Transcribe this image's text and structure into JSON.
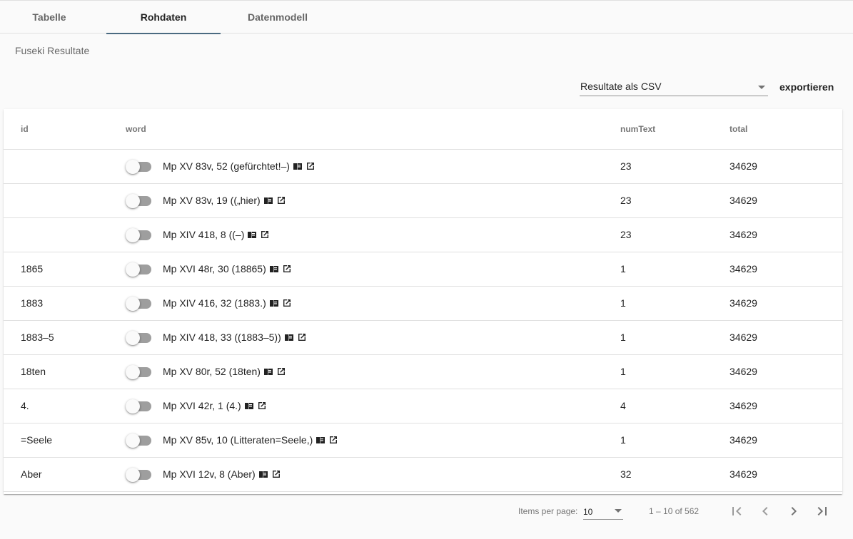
{
  "tabs": [
    {
      "label": "Tabelle",
      "active": false
    },
    {
      "label": "Rohdaten",
      "active": true
    },
    {
      "label": "Datenmodell",
      "active": false
    }
  ],
  "section_title": "Fuseki Resultate",
  "export": {
    "selected": "Resultate als CSV",
    "button_label": "exportieren"
  },
  "table": {
    "columns": [
      "id",
      "word",
      "numText",
      "total"
    ],
    "rows": [
      {
        "id": "",
        "word": "Mp XV 83v, 52 (gefürchtet!–)",
        "numText": "23",
        "total": "34629"
      },
      {
        "id": "",
        "word": "Mp XV 83v, 19 ((„hier)",
        "numText": "23",
        "total": "34629"
      },
      {
        "id": "",
        "word": "Mp XIV 418, 8 ((–)",
        "numText": "23",
        "total": "34629"
      },
      {
        "id": "1865",
        "word": "Mp XVI 48r, 30 (18865)",
        "numText": "1",
        "total": "34629"
      },
      {
        "id": "1883",
        "word": "Mp XIV 416, 32 (1883.)",
        "numText": "1",
        "total": "34629"
      },
      {
        "id": "1883–5",
        "word": "Mp XIV 418, 33 ((1883–5))",
        "numText": "1",
        "total": "34629"
      },
      {
        "id": "18ten",
        "word": "Mp XV 80r, 52 (18ten)",
        "numText": "1",
        "total": "34629"
      },
      {
        "id": "4.",
        "word": "Mp XVI 42r, 1 (4.)",
        "numText": "4",
        "total": "34629"
      },
      {
        "id": "=Seele",
        "word": "Mp XV 85v, 10 (Litteraten=Seele,)",
        "numText": "1",
        "total": "34629"
      },
      {
        "id": "Aber",
        "word": "Mp XVI 12v, 8 (Aber)",
        "numText": "32",
        "total": "34629"
      }
    ]
  },
  "paginator": {
    "items_per_page_label": "Items per page:",
    "items_per_page": "10",
    "range_label": "1 – 10 of 562"
  },
  "icons": {
    "row_icons": [
      "book-icon",
      "open-in-new-icon"
    ],
    "pager": [
      "first-page-icon",
      "chevron-left-icon",
      "chevron-right-icon",
      "last-page-icon"
    ]
  },
  "colors": {
    "tab_indicator": "#4a6a80"
  }
}
